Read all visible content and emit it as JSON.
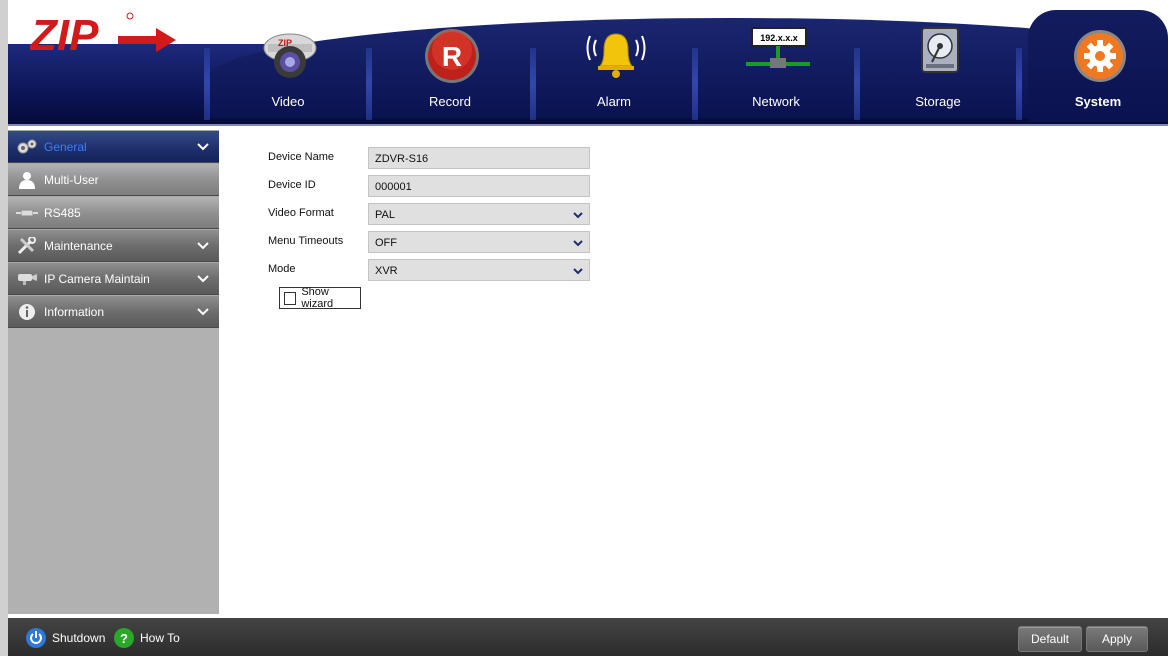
{
  "header": {
    "logo_text": "ZIP",
    "tabs": [
      {
        "label": "Video",
        "icon": "camera-icon"
      },
      {
        "label": "Record",
        "icon": "record-icon",
        "badge": "R"
      },
      {
        "label": "Alarm",
        "icon": "bell-icon"
      },
      {
        "label": "Network",
        "icon": "network-icon",
        "badge": "192.x.x.x"
      },
      {
        "label": "Storage",
        "icon": "hard-drive-icon"
      },
      {
        "label": "System",
        "icon": "gear-icon",
        "active": true
      }
    ]
  },
  "sidebar": {
    "items": [
      {
        "label": "General",
        "icon": "gears-icon",
        "active": true,
        "expandable": true
      },
      {
        "label": "Multi-User",
        "icon": "user-icon",
        "sub": true
      },
      {
        "label": "RS485",
        "icon": "connector-icon",
        "sub": true
      },
      {
        "label": "Maintenance",
        "icon": "tools-icon",
        "expandable": true
      },
      {
        "label": "IP Camera Maintain",
        "icon": "ip-camera-icon",
        "expandable": true
      },
      {
        "label": "Information",
        "icon": "info-icon",
        "expandable": true
      }
    ]
  },
  "form": {
    "device_name": {
      "label": "Device Name",
      "value": "ZDVR-S16"
    },
    "device_id": {
      "label": "Device ID",
      "value": "000001"
    },
    "video_format": {
      "label": "Video Format",
      "value": "PAL"
    },
    "menu_timeouts": {
      "label": "Menu Timeouts",
      "value": "OFF"
    },
    "mode": {
      "label": "Mode",
      "value": "XVR"
    },
    "show_wizard": {
      "label": "Show wizard",
      "checked": false
    }
  },
  "footer": {
    "shutdown_label": "Shutdown",
    "howto_label": "How To",
    "default_label": "Default",
    "apply_label": "Apply"
  },
  "colors": {
    "header_navy": "#0a1250",
    "active_blue": "#3d7df0",
    "record_red": "#c0201a",
    "system_orange": "#f07820",
    "alarm_yellow": "#f2c40c"
  }
}
